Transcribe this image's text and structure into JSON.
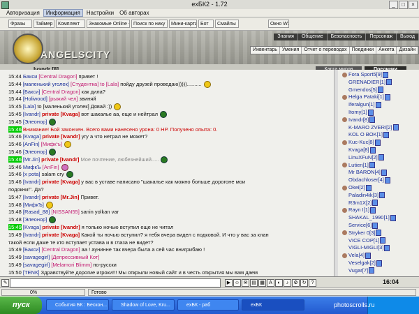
{
  "window": {
    "title": "exБК2 - 1.72"
  },
  "menu": [
    "Авторизация",
    "Информация",
    "Настройки",
    "Об авторах"
  ],
  "toolbar": [
    "Фразы",
    "Таймер",
    "Комплект",
    "Знакомые Online -",
    "Поиск по нику",
    "Мини-карта",
    "Бот",
    "Смайлы",
    "Окно W2"
  ],
  "header": {
    "logo_text": "ANGELSCITY",
    "top_nav": [
      "Знания",
      "Общение",
      "Безопасность",
      "Персонаж",
      "Выход"
    ],
    "sub_nav": [
      "Инвентарь",
      "Умения",
      "Отчет о переводах",
      "Поединки",
      "Анкета",
      "Дизайн"
    ],
    "user": "Ivandr [8]",
    "map_button": "Карта миров",
    "fights_button": "Поединки"
  },
  "chat": [
    {
      "t": "15:44",
      "n": "Бакси",
      "to": "[Central Dragon]",
      "m": "привет !"
    },
    {
      "t": "15:44",
      "n": "[маленький уголек]",
      "to": "[Студентка] to [Lala]",
      "m": "пойду друзей проведаю)))))..........",
      "e": "y"
    },
    {
      "t": "15:44",
      "n": "[Бакси]",
      "to": "[Central Dragon]",
      "m": "как дила?"
    },
    {
      "t": "15:44",
      "n": "[Holiwood]",
      "to": "[рыжий чел]",
      "m": "звиняй"
    },
    {
      "t": "15:45",
      "n": "[Lala]",
      "m": "to [маленький уголек] Дявай :))",
      "e": "y"
    },
    {
      "t": "15:45",
      "n": "[Ivandr]",
      "p": "private [Kvaga]",
      "m": "вот шакалье аа, еще и нейтрал",
      "e": "g"
    },
    {
      "t": "15:45",
      "n": "[Элеонор]",
      "e": "g"
    },
    {
      "t": "15:46",
      "hl": true,
      "sys": "Внимание! Бой закончен. Всего вами нанесено урона: 0 HP. Получено опыта: 0."
    },
    {
      "t": "15:46",
      "n": "[Kvaga]",
      "p": "private [Ivandr]",
      "m": "угу а что нетрал не может?"
    },
    {
      "t": "15:46",
      "n": "[AnFin]",
      "to": "[Мифк'ъ]",
      "e": "y"
    },
    {
      "t": "15:46",
      "n": "[Элеонор]",
      "e": "g"
    },
    {
      "t": "15:46",
      "hl": true,
      "n": "[Mr.Jin]",
      "p": "private [Ivandr]",
      "gr": "Мое почтение, любезнейший.....",
      "e": "g"
    },
    {
      "t": "15:46",
      "n": "МифкЪ",
      "to": "[AnFin]",
      "e": "p"
    },
    {
      "t": "15:46",
      "n": "[x pota]",
      "m": "salam  cry",
      "e": "g"
    },
    {
      "t": "15:46",
      "n": "[Ivandr]",
      "p": "private [Kvaga]",
      "m": "у вас в уставе написано \"шакалье как можно больше дорогоне мои"
    },
    {
      "t": "",
      "m": "подокни!\". Да?"
    },
    {
      "t": "15:47",
      "n": "[Ivandr]",
      "p": "private [Mr.Jin]",
      "m": "Привет."
    },
    {
      "t": "15:48",
      "n": "[МифкЪ]",
      "e": "y"
    },
    {
      "t": "15:48",
      "n": "[Rasad_88]",
      "to": "[NISSAN55]",
      "m": "sanin yolkan var"
    },
    {
      "t": "15:48",
      "n": "[Элеонор]",
      "e": "g"
    },
    {
      "t": "15:49",
      "hl": true,
      "n": "[Kvaga]",
      "p": "private [Ivandr]",
      "m": "я только ночью вступил еще не читал"
    },
    {
      "t": "15:49",
      "n": "[Ivandr]",
      "p": "private [Kvaga]",
      "m": "Какой ты ночью вступил? я тебя вчера видел с подковой. И что у вас за клан"
    },
    {
      "t": "",
      "m": "такой если даже те кто вступает устава и в глаза не видет?"
    },
    {
      "t": "15:49",
      "n": "[Бакси]",
      "to": "[Central Dragon]",
      "m": "аа ! аунинне так вчера была а сей час внигрибаю !"
    },
    {
      "t": "15:49",
      "n": "[savagegirl]",
      "to": "[Депрессивный Кот]"
    },
    {
      "t": "15:49",
      "n": "[savagegirl]",
      "to": "[Melamori Blimm]",
      "m": "по-русски"
    },
    {
      "t": "15:50",
      "n": "[ТЕNК]",
      "m": "Здравствуйте дорогие игроки!!! Мы открыли новый сайт и в честь открытия мы вам даем"
    }
  ],
  "users": [
    "Fora Sport5[9]",
    "GRENADIER[1]",
    "Gmendos[5]",
    "Helga Pataki[1]",
    "Iferalgun[1]",
    "Itomy[1]",
    "Ivandr[8]",
    "K-MARO ZVERI[2]",
    "KOL O BOK[1]",
    "Kuc-Kuc[8]",
    "Kvaga[8]",
    "LinuXFuN[2]",
    "Lutien[1]",
    "Mr BARON[4]",
    "Obdachloser[4]",
    "Okei[2]",
    "Paladin4ik[3]",
    "R3m1X[2]",
    "Rayn I[1]",
    "SHAKAL_1990[1]",
    "Service[6]",
    "Stryker 0[3]",
    "VICE COP[1]",
    "VIGLI-MIGLI[3]",
    "Vela[4]",
    "Veselgak[2]",
    "Vugar[7]"
  ],
  "input": {
    "clock": "16:04"
  },
  "status": {
    "progress": "0%",
    "state": "Готово"
  },
  "taskbar": {
    "start": "пуск",
    "tasks": [
      "События БК : Бескон...",
      "Shadow of Love, Kru...",
      "exБК - раб",
      "exБК"
    ],
    "watermark": "photoscrolls.ru"
  }
}
